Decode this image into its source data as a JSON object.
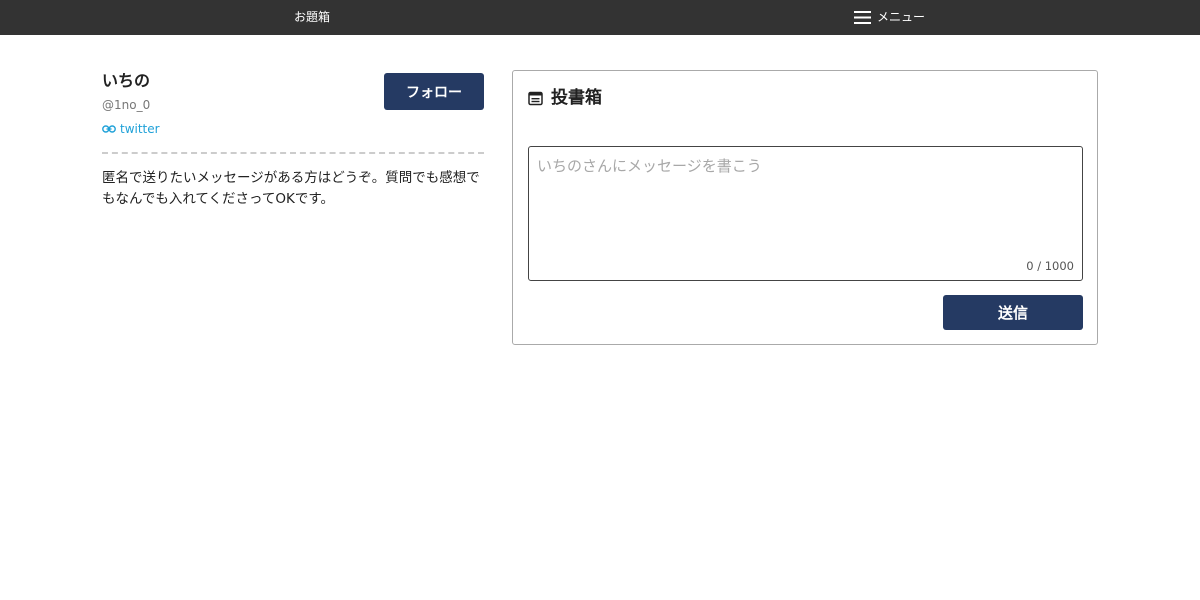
{
  "header": {
    "brand": "お題箱",
    "menu_label": "メニュー",
    "menu_icon": "hamburger-icon"
  },
  "profile": {
    "name": "いちの",
    "handle": "@1no_0",
    "link_label": "twitter",
    "link_icon": "link-icon",
    "follow_label": "フォロー",
    "bio": "匿名で送りたいメッセージがある方はどうぞ。質問でも感想でもなんでも入れてくださってOKです。"
  },
  "postbox": {
    "title": "投書箱",
    "title_icon": "inbox-icon",
    "placeholder": "いちのさんにメッセージを書こう",
    "value": "",
    "counter": "0 / 1000",
    "send_label": "送信"
  },
  "colors": {
    "header_bg": "#333333",
    "button_bg": "#253a63",
    "link": "#1fa1d8",
    "divider": "#cccccc"
  }
}
